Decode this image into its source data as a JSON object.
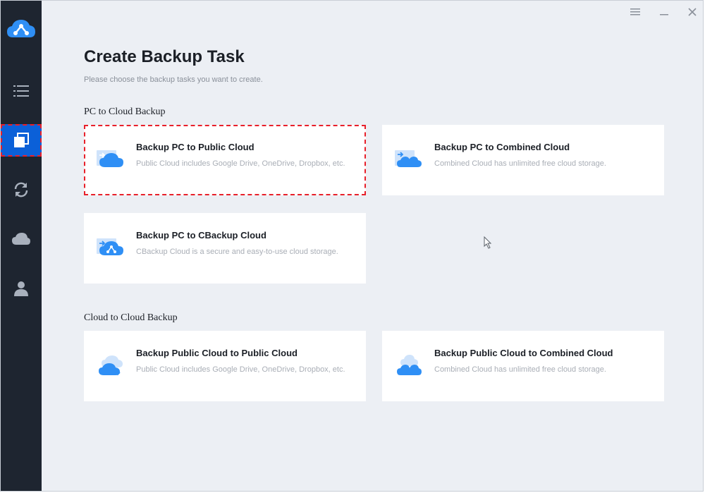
{
  "window": {
    "menu_icon": "menu-icon",
    "minimize_icon": "minimize-icon",
    "close_icon": "close-icon"
  },
  "sidebar": {
    "logo_icon": "cbackup-logo-icon",
    "items": [
      {
        "icon": "task-list-icon",
        "active": false
      },
      {
        "icon": "backup-icon",
        "active": true
      },
      {
        "icon": "sync-icon",
        "active": false
      },
      {
        "icon": "cloud-icon",
        "active": false
      },
      {
        "icon": "user-icon",
        "active": false
      }
    ]
  },
  "main": {
    "title": "Create Backup Task",
    "subtitle": "Please choose the backup tasks you want to create.",
    "sections": [
      {
        "title": "PC to Cloud Backup",
        "cards": [
          {
            "title": "Backup PC to Public Cloud",
            "desc": "Public Cloud includes Google Drive, OneDrive, Dropbox, etc.",
            "icon": "pc-to-public-cloud-icon"
          },
          {
            "title": "Backup PC to Combined Cloud",
            "desc": "Combined Cloud has unlimited free cloud storage.",
            "icon": "pc-to-combined-cloud-icon"
          },
          {
            "title": "Backup PC to CBackup Cloud",
            "desc": "CBackup Cloud is a secure and easy-to-use cloud storage.",
            "icon": "pc-to-cbackup-cloud-icon"
          }
        ]
      },
      {
        "title": "Cloud to Cloud Backup",
        "cards": [
          {
            "title": "Backup Public Cloud to Public Cloud",
            "desc": "Public Cloud includes Google Drive, OneDrive, Dropbox, etc.",
            "icon": "cloud-to-cloud-icon"
          },
          {
            "title": "Backup Public Cloud to Combined Cloud",
            "desc": "Combined Cloud has unlimited free cloud storage.",
            "icon": "cloud-to-combined-cloud-icon"
          }
        ]
      }
    ]
  },
  "colors": {
    "sidebar_bg": "#1e2530",
    "accent": "#0b60d8",
    "content_bg": "#eceff4",
    "highlight": "#e8202a",
    "icon_blue": "#2f8ff5"
  }
}
